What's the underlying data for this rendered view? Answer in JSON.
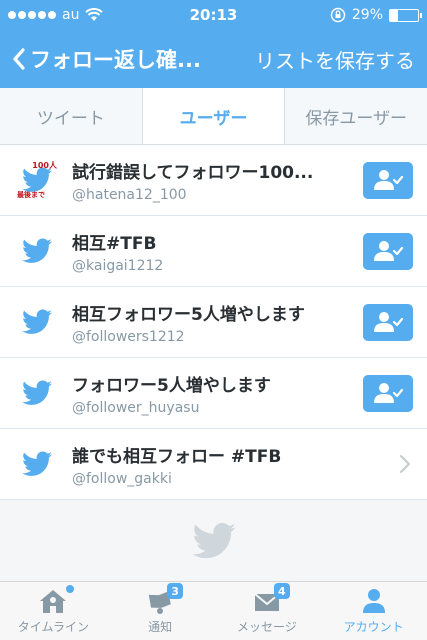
{
  "status_bar": {
    "carrier": "au",
    "time": "20:13",
    "battery": "29%",
    "battery_level": 0.29
  },
  "nav": {
    "title": "フォロー返し確...",
    "action": "リストを保存する"
  },
  "tabs": [
    {
      "label": "ツイート",
      "active": false
    },
    {
      "label": "ユーザー",
      "active": true
    },
    {
      "label": "保存ユーザー",
      "active": false
    }
  ],
  "avatar_badge": {
    "top": "100人",
    "bottom": "最後まで"
  },
  "users": [
    {
      "name": "試行錯誤してフォロワー100...",
      "handle": "@hatena12_100",
      "action": "follow"
    },
    {
      "name": "相互#TFB",
      "handle": "@kaigai1212",
      "action": "follow"
    },
    {
      "name": "相互フォロワー5人増やします",
      "handle": "@followers1212",
      "action": "follow"
    },
    {
      "name": "フォロワー5人増やします",
      "handle": "@follower_huyasu",
      "action": "follow"
    },
    {
      "name": "誰でも相互フォロー #TFB",
      "handle": "@follow_gakki",
      "action": "chevron"
    }
  ],
  "tab_bar": {
    "items": [
      {
        "label": "タイムライン",
        "icon": "home-icon",
        "badge": ""
      },
      {
        "label": "通知",
        "icon": "bell-icon",
        "badge": "3"
      },
      {
        "label": "メッセージ",
        "icon": "envelope-icon",
        "badge": "4"
      },
      {
        "label": "アカウント",
        "icon": "person-icon",
        "badge": ""
      }
    ]
  },
  "colors": {
    "brand": "#55acee",
    "text": "#292f33",
    "muted": "#8899a6"
  }
}
